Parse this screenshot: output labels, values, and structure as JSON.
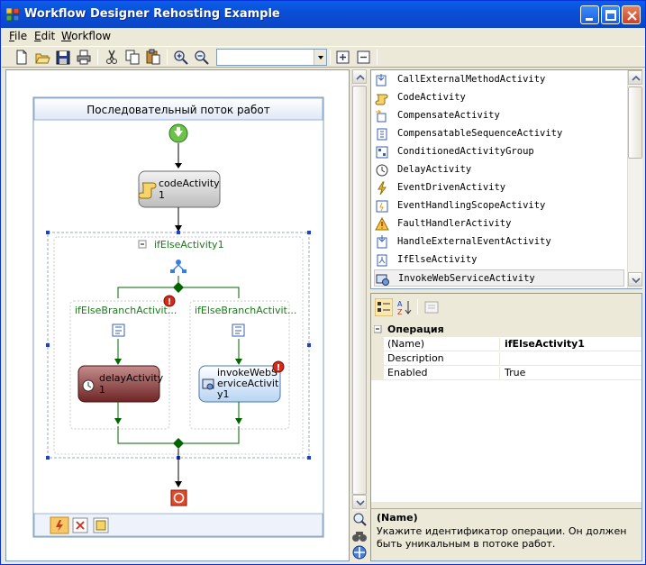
{
  "window": {
    "title": "Workflow Designer Rehosting Example"
  },
  "menu": [
    {
      "label": "File",
      "accel": "F",
      "rest": "ile"
    },
    {
      "label": "Edit",
      "accel": "E",
      "rest": "dit"
    },
    {
      "label": "Workflow",
      "accel": "W",
      "rest": "orkflow"
    }
  ],
  "toolbar": {
    "buttons": [
      "new-icon",
      "open-icon",
      "save-icon",
      "print-icon",
      "cut-icon",
      "copy-icon",
      "paste-icon",
      "zoom-in-icon",
      "zoom-out-icon",
      "expand-icon",
      "collapse-icon"
    ],
    "combo_value": ""
  },
  "designer": {
    "workflow_title": "Последовательный поток работ",
    "code_activity": {
      "line1": "codeActivity",
      "line2": "1"
    },
    "ifelse": {
      "label": "ifElseActivity1",
      "collapse": "−"
    },
    "branch_left": {
      "label": "ifElseBranchActivit..."
    },
    "branch_right": {
      "label": "ifElseBranchActivit..."
    },
    "delay_activity": {
      "line1": "delayActivity",
      "line2": "1"
    },
    "invoke_activity": {
      "line1": "invokeWebS",
      "line2": "erviceActivit",
      "line3": "y1"
    },
    "warning_glyph": "!"
  },
  "toolbox": {
    "items": [
      {
        "label": "CallExternalMethodActivity",
        "icon": "call-external-method-icon"
      },
      {
        "label": "CodeActivity",
        "icon": "code-scroll-icon"
      },
      {
        "label": "CompensateActivity",
        "icon": "compensate-icon"
      },
      {
        "label": "CompensatableSequenceActivity",
        "icon": "compensatable-sequence-icon"
      },
      {
        "label": "ConditionedActivityGroup",
        "icon": "conditioned-group-icon"
      },
      {
        "label": "DelayActivity",
        "icon": "clock-icon"
      },
      {
        "label": "EventDrivenActivity",
        "icon": "event-driven-icon"
      },
      {
        "label": "EventHandlingScopeActivity",
        "icon": "event-scope-icon"
      },
      {
        "label": "FaultHandlerActivity",
        "icon": "fault-handler-icon"
      },
      {
        "label": "HandleExternalEventActivity",
        "icon": "handle-event-icon"
      },
      {
        "label": "IfElseActivity",
        "icon": "ifelse-icon"
      },
      {
        "label": "InvokeWebServiceActivity",
        "icon": "web-service-icon"
      }
    ],
    "selected_index": 11
  },
  "properties": {
    "category": "Операция",
    "rows": [
      {
        "key": "(Name)",
        "value": "ifElseActivity1",
        "bold": true
      },
      {
        "key": "Description",
        "value": ""
      },
      {
        "key": "Enabled",
        "value": "True"
      }
    ],
    "description_title": "(Name)",
    "description_text": "Укажите идентификатор операции. Он должен быть уникальным в потоке работ."
  },
  "colors": {
    "title_bar": "#0b4fd6",
    "connector": "#006400",
    "ifelse_label": "#1a7a1a",
    "error_badge": "#d42a1a"
  }
}
